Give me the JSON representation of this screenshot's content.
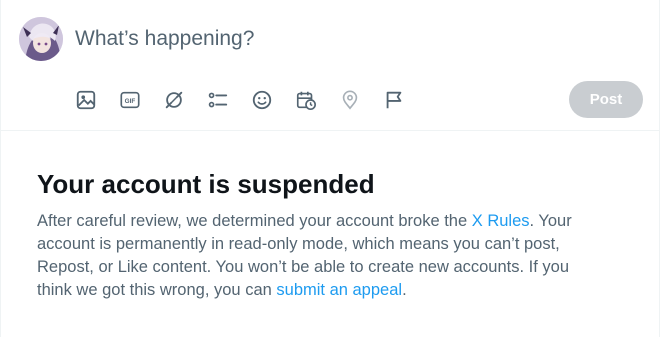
{
  "composer": {
    "placeholder": "What’s happening?",
    "post_label": "Post",
    "toolbar": [
      {
        "icon": "image-icon"
      },
      {
        "icon": "gif-icon",
        "text": "GIF"
      },
      {
        "icon": "grok-icon"
      },
      {
        "icon": "poll-icon"
      },
      {
        "icon": "emoji-icon"
      },
      {
        "icon": "schedule-icon"
      },
      {
        "icon": "location-icon",
        "disabled": true
      },
      {
        "icon": "flag-icon"
      }
    ]
  },
  "notice": {
    "title": "Your account is suspended",
    "body_part1": "After careful review, we determined your account broke the ",
    "rules_link": "X Rules",
    "body_part2": ". Your account is permanently in read-only mode, which means you can’t post, Repost, or Like content. You won’t be able to create new accounts. If you think we got this wrong, you can ",
    "appeal_link": "submit an appeal",
    "body_part3": "."
  },
  "colors": {
    "accent": "#1d9bf0",
    "icon": "#536471",
    "text": "#0f1419",
    "secondary_text": "#536471",
    "post_button_disabled": "#c9cdd1"
  }
}
